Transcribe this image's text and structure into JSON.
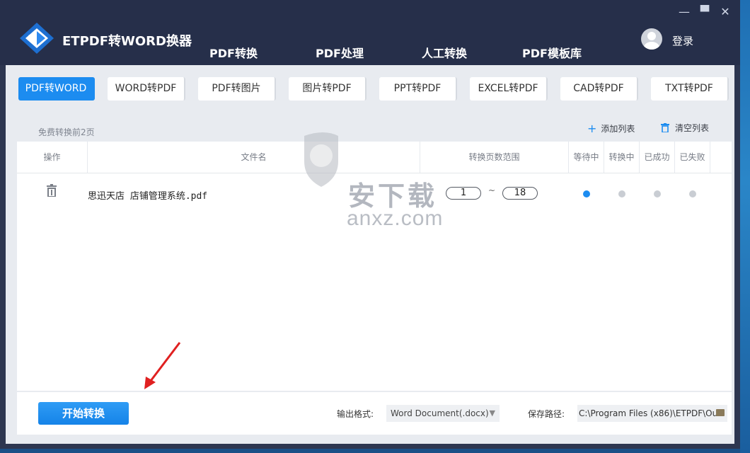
{
  "app": {
    "title": "ETPDF转WORD换器"
  },
  "nav": {
    "tabs": [
      {
        "label": "PDF转换",
        "active": true
      },
      {
        "label": "PDF处理",
        "active": false
      },
      {
        "label": "人工转换",
        "active": false
      },
      {
        "label": "PDF模板库",
        "active": false
      }
    ]
  },
  "window_controls": {
    "minimize": "—",
    "maximize": "▀",
    "close": "✕"
  },
  "user": {
    "login_label": "登录"
  },
  "types": [
    {
      "label": "PDF转WORD",
      "active": true
    },
    {
      "label": "WORD转PDF",
      "active": false
    },
    {
      "label": "PDF转图片",
      "active": false
    },
    {
      "label": "图片转PDF",
      "active": false
    },
    {
      "label": "PPT转PDF",
      "active": false
    },
    {
      "label": "EXCEL转PDF",
      "active": false
    },
    {
      "label": "CAD转PDF",
      "active": false
    },
    {
      "label": "TXT转PDF",
      "active": false
    }
  ],
  "toolbar": {
    "free_note": "免费转换前2页",
    "add_list": "添加列表",
    "clear_list": "清空列表"
  },
  "table": {
    "columns": [
      "操作",
      "文件名",
      "转换页数范围",
      "等待中",
      "转换中",
      "已成功",
      "已失败"
    ],
    "rows": [
      {
        "filename": "思迅天店 店铺管理系统.pdf",
        "page_from": "1",
        "page_sep": "~",
        "page_to": "18",
        "status": "等待中"
      }
    ]
  },
  "watermark": {
    "cn": "安下载",
    "en": "anxz.com"
  },
  "bottom": {
    "start_label": "开始转换",
    "output_format_label": "输出格式:",
    "output_format_value": "Word Document(.docx)",
    "save_path_label": "保存路径:",
    "save_path_value": "C:\\Program Files (x86)\\ETPDF\\Ou"
  },
  "colors": {
    "accent": "#1c8cf0",
    "header": "#262f4a",
    "annotation_arrow": "#e02020"
  }
}
